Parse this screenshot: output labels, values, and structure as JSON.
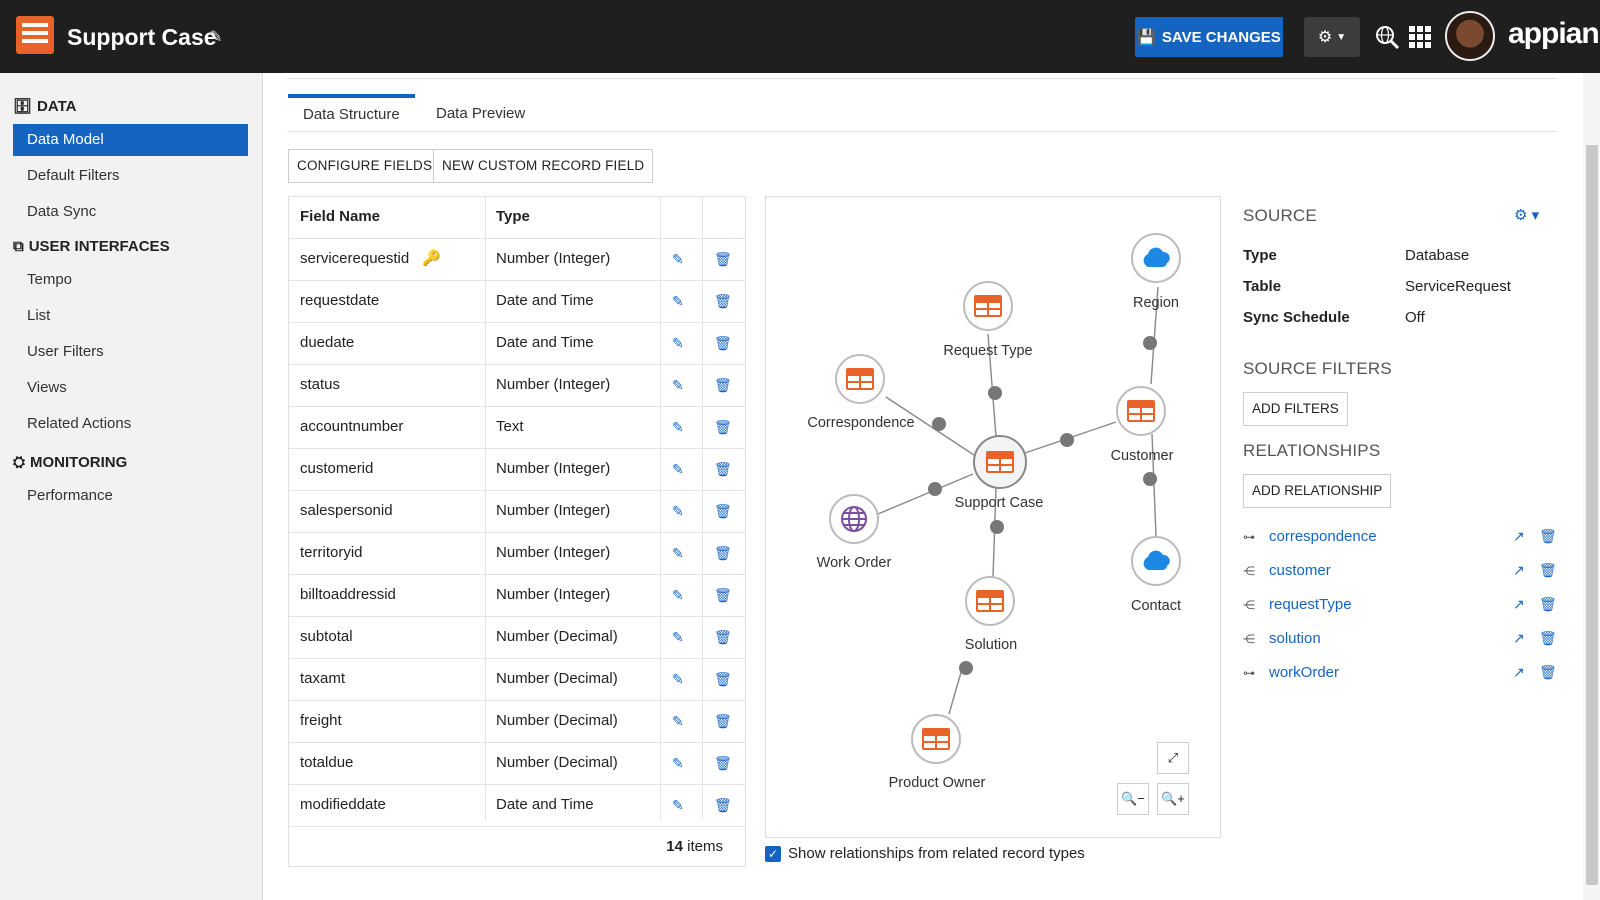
{
  "header": {
    "app_title": "Support Case",
    "save_label": "SAVE CHANGES",
    "brand": "appian",
    "logo_icon": "record-type-icon"
  },
  "sidebar": {
    "sections": [
      {
        "title": "DATA",
        "icon": "database-icon",
        "items": [
          "Data Model",
          "Default Filters",
          "Data Sync"
        ]
      },
      {
        "title": "USER INTERFACES",
        "icon": "interface-icon",
        "items": [
          "Tempo",
          "List",
          "User Filters",
          "Views",
          "Related Actions"
        ]
      },
      {
        "title": "MONITORING",
        "icon": "monitoring-icon",
        "items": [
          "Performance"
        ]
      }
    ],
    "active_item": "Data Model"
  },
  "tabs": [
    "Data Structure",
    "Data Preview"
  ],
  "buttons": {
    "configure": "CONFIGURE FIELDS",
    "new_field": "NEW CUSTOM RECORD FIELD"
  },
  "table": {
    "headers": [
      "Field Name",
      "Type"
    ],
    "rows": [
      {
        "name": "servicerequestid",
        "type": "Number (Integer)",
        "key": true
      },
      {
        "name": "requestdate",
        "type": "Date and Time"
      },
      {
        "name": "duedate",
        "type": "Date and Time"
      },
      {
        "name": "status",
        "type": "Number (Integer)"
      },
      {
        "name": "accountnumber",
        "type": "Text"
      },
      {
        "name": "customerid",
        "type": "Number (Integer)"
      },
      {
        "name": "salespersonid",
        "type": "Number (Integer)"
      },
      {
        "name": "territoryid",
        "type": "Number (Integer)"
      },
      {
        "name": "billtoaddressid",
        "type": "Number (Integer)"
      },
      {
        "name": "subtotal",
        "type": "Number (Decimal)"
      },
      {
        "name": "taxamt",
        "type": "Number (Decimal)"
      },
      {
        "name": "freight",
        "type": "Number (Decimal)"
      },
      {
        "name": "totaldue",
        "type": "Number (Decimal)"
      },
      {
        "name": "modifieddate",
        "type": "Date and Time"
      }
    ],
    "count": "14",
    "count_label": "items"
  },
  "diagram": {
    "nodes": {
      "center": "Support Case",
      "request_type": "Request Type",
      "region": "Region",
      "correspondence": "Correspondence",
      "customer": "Customer",
      "work_order": "Work Order",
      "contact": "Contact",
      "solution": "Solution",
      "product_owner": "Product Owner"
    },
    "show_related_label": "Show relationships from related record types",
    "show_related_checked": true
  },
  "source": {
    "title": "SOURCE",
    "type_key": "Type",
    "type_val": "Database",
    "table_key": "Table",
    "table_val": "ServiceRequest",
    "sync_key": "Sync Schedule",
    "sync_val": "Off",
    "filters_title": "SOURCE FILTERS",
    "add_filters": "ADD FILTERS",
    "relationships_title": "RELATIONSHIPS",
    "add_relationship": "ADD RELATIONSHIP",
    "relationships": [
      "correspondence",
      "customer",
      "requestType",
      "solution",
      "workOrder"
    ]
  },
  "colors": {
    "accent": "#1565c0",
    "brand_orange": "#e8622a",
    "topbar": "#1f1f1f"
  }
}
